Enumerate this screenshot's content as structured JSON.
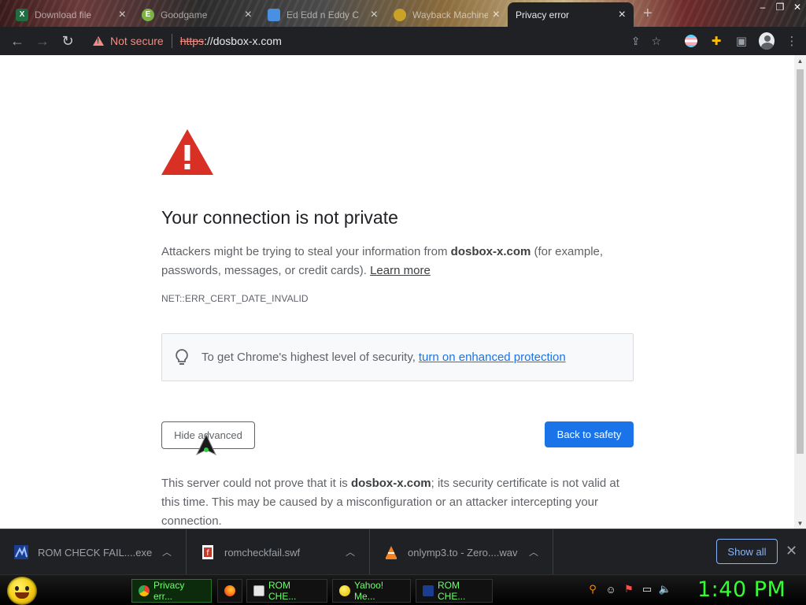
{
  "tabs": [
    {
      "title": "Download file",
      "icon": "excel-icon",
      "icon_color": "#1d6f42"
    },
    {
      "title": "Goodgame",
      "icon": "goodgame-icon",
      "icon_color": "#7cb342"
    },
    {
      "title": "Ed Edd n Eddy C",
      "icon": "cartoon-icon",
      "icon_color": "#4a90e2"
    },
    {
      "title": "Wayback Machine",
      "icon": "wayback-icon",
      "icon_color": "#c9a227"
    },
    {
      "title": "Privacy error",
      "icon": "",
      "icon_color": ""
    }
  ],
  "address_bar": {
    "security_label": "Not secure",
    "url_scheme": "https",
    "url_rest": "://dosbox-x.com"
  },
  "page": {
    "heading": "Your connection is not private",
    "intro_prefix": "Attackers might be trying to steal your information from ",
    "domain": "dosbox-x.com",
    "intro_suffix": " (for example, passwords, messages, or credit cards). ",
    "learn_more": "Learn more",
    "error_code": "NET::ERR_CERT_DATE_INVALID",
    "enhanced_text": "To get Chrome's highest level of security,",
    "enhanced_link": "turn on enhanced protection",
    "hide_advanced": "Hide advanced",
    "back_to_safety": "Back to safety",
    "details_prefix": "This server could not prove that it is ",
    "details_domain": "dosbox-x.com",
    "details_suffix": "; its security certificate is not valid at this time. This may be caused by a misconfiguration or an attacker intercepting your connection."
  },
  "downloads": [
    {
      "name": "ROM CHECK FAIL....exe",
      "icon": "exe-icon"
    },
    {
      "name": "romcheckfail.swf",
      "icon": "flash-file-icon"
    },
    {
      "name": "onlymp3.to - Zero....wav",
      "icon": "vlc-icon"
    }
  ],
  "download_bar": {
    "show_all": "Show all"
  },
  "taskbar": {
    "items": [
      {
        "label": "Privacy err...",
        "icon": "chrome-icon",
        "active": true
      },
      {
        "label": "",
        "icon": "firefox-icon",
        "active": false
      },
      {
        "label": "ROM CHE...",
        "icon": "flash-icon",
        "active": false
      },
      {
        "label": "Yahoo! Me...",
        "icon": "yahoo-messenger-icon",
        "active": false
      },
      {
        "label": "ROM CHE...",
        "icon": "exe-icon",
        "active": false
      }
    ],
    "clock": "1:40 PM"
  },
  "colors": {
    "accent_blue": "#1a73e8",
    "warning_red": "#d93025",
    "toolbar_bg": "#202124",
    "clock_green": "#32ff32"
  }
}
